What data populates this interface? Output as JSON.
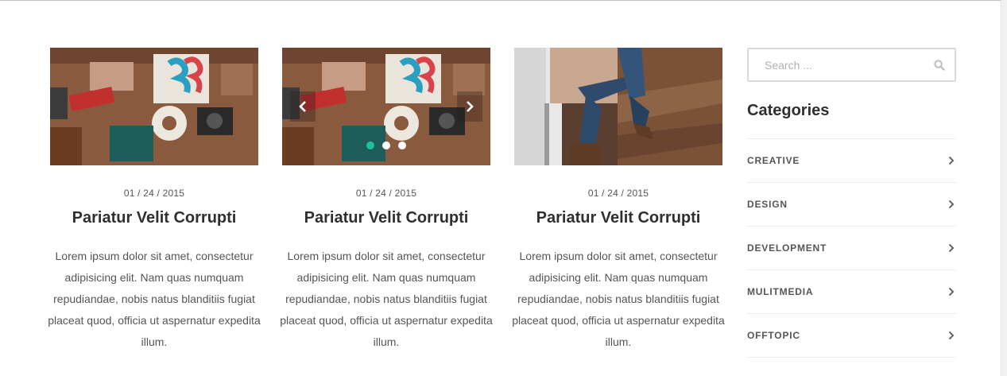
{
  "posts": [
    {
      "date": "01 / 24 / 2015",
      "title": "Pariatur Velit Corrupti",
      "excerpt": "Lorem ipsum dolor sit amet, consectetur adipisicing elit. Nam quas numquam repudiandae, nobis natus blanditiis fugiat placeat quod, officia ut aspernatur expedita illum.",
      "media_type": "image"
    },
    {
      "date": "01 / 24 / 2015",
      "title": "Pariatur Velit Corrupti",
      "excerpt": "Lorem ipsum dolor sit amet, consectetur adipisicing elit. Nam quas numquam repudiandae, nobis natus blanditiis fugiat placeat quod, officia ut aspernatur expedita illum.",
      "media_type": "slider",
      "slider": {
        "slide_count": 3,
        "active_slide": 1
      }
    },
    {
      "date": "01 / 24 / 2015",
      "title": "Pariatur Velit Corrupti",
      "excerpt": "Lorem ipsum dolor sit amet, consectetur adipisicing elit. Nam quas numquam repudiandae, nobis natus blanditiis fugiat placeat quod, officia ut aspernatur expedita illum.",
      "media_type": "image"
    }
  ],
  "sidebar": {
    "search": {
      "placeholder": "Search ...",
      "value": ""
    },
    "categories_title": "Categories",
    "categories": [
      {
        "label": "CREATIVE"
      },
      {
        "label": "DESIGN"
      },
      {
        "label": "DEVELOPMENT"
      },
      {
        "label": "MULITMEDIA"
      },
      {
        "label": "OFFTOPIC"
      }
    ]
  },
  "icons": {
    "search": "search-icon",
    "category_arrow": "chevron-right-icon",
    "slider_prev": "chevron-left-icon",
    "slider_next": "chevron-right-icon"
  },
  "colors": {
    "accent": "#1cc39a",
    "heading": "#2f2f2f",
    "body_text": "#555555",
    "divider": "#ececec"
  }
}
